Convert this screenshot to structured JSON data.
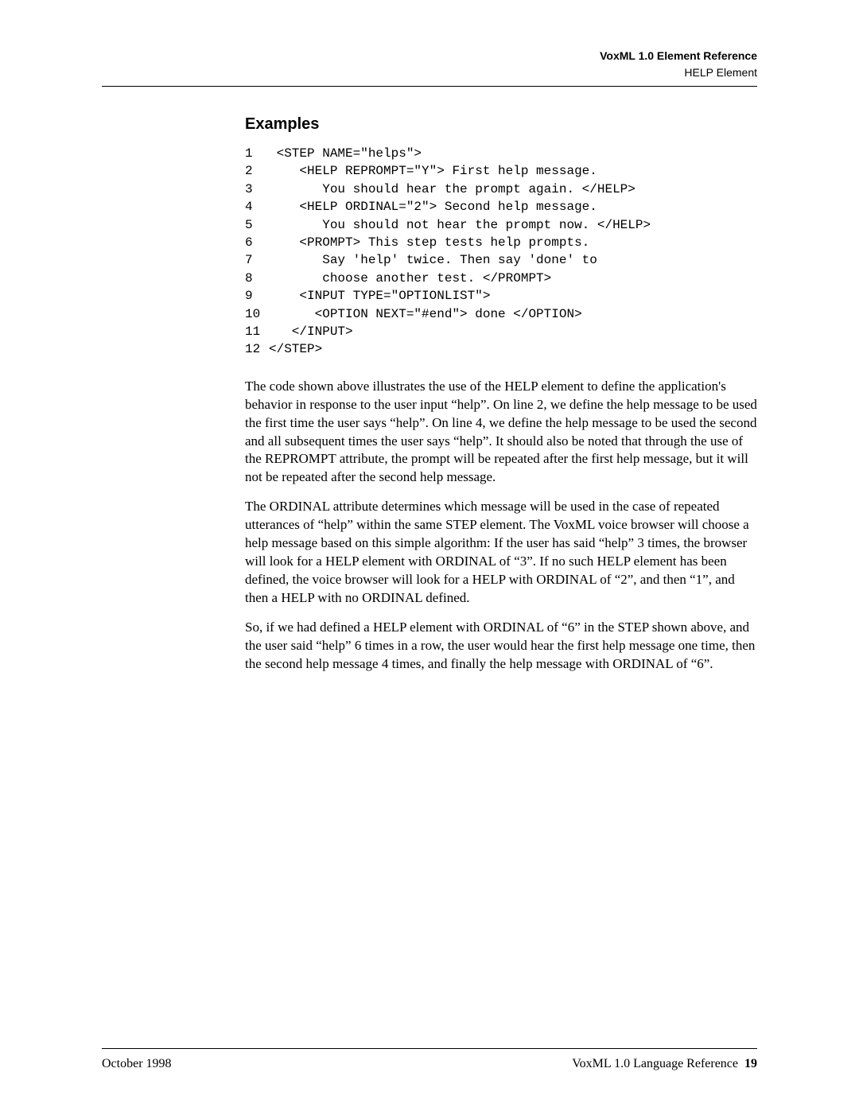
{
  "header": {
    "title": "VoxML 1.0 Element Reference",
    "subtitle": "HELP Element"
  },
  "section_heading": "Examples",
  "code": {
    "lines": [
      {
        "n": "1",
        "t": " <STEP NAME=\"helps\">"
      },
      {
        "n": "2",
        "t": "    <HELP REPROMPT=\"Y\"> First help message."
      },
      {
        "n": "3",
        "t": "       You should hear the prompt again. </HELP>"
      },
      {
        "n": "4",
        "t": "    <HELP ORDINAL=\"2\"> Second help message."
      },
      {
        "n": "5",
        "t": "       You should not hear the prompt now. </HELP>"
      },
      {
        "n": "6",
        "t": "    <PROMPT> This step tests help prompts."
      },
      {
        "n": "7",
        "t": "       Say 'help' twice. Then say 'done' to"
      },
      {
        "n": "8",
        "t": "       choose another test. </PROMPT>"
      },
      {
        "n": "9",
        "t": "    <INPUT TYPE=\"OPTIONLIST\">"
      },
      {
        "n": "10",
        "t": "      <OPTION NEXT=\"#end\"> done </OPTION>"
      },
      {
        "n": "11",
        "t": "   </INPUT>"
      },
      {
        "n": "12",
        "t": "</STEP>"
      }
    ]
  },
  "paragraphs": [
    "The code shown above illustrates the use of the HELP element to define the application's behavior in response to the user input “help”.  On line 2, we define the help message to be used the first time the user says “help”.  On line 4, we define the help message to be used the second and all subsequent times the user says “help”.  It should also be noted that through the use of the REPROMPT attribute, the prompt will be repeated after the first help message, but it will not be repeated after the second help message.",
    "The ORDINAL attribute determines which message will be used in the case of repeated utterances of “help” within the same STEP element.  The VoxML voice browser will choose a help message based on this simple algorithm: If the user has said “help” 3 times, the browser will look for a  HELP element with ORDINAL of “3”.  If no such HELP element has been defined, the voice browser will look for a HELP with ORDINAL of “2”, and then “1”, and then a HELP with no ORDINAL defined.",
    "So, if we had defined a HELP element with ORDINAL of “6” in the STEP shown above, and the user said “help” 6 times in a row, the user would hear the first help message one time, then the second help message 4 times, and finally the help message with ORDINAL of “6”."
  ],
  "footer": {
    "left": "October 1998",
    "right_text": "VoxML 1.0 Language Reference",
    "page_number": "19"
  }
}
